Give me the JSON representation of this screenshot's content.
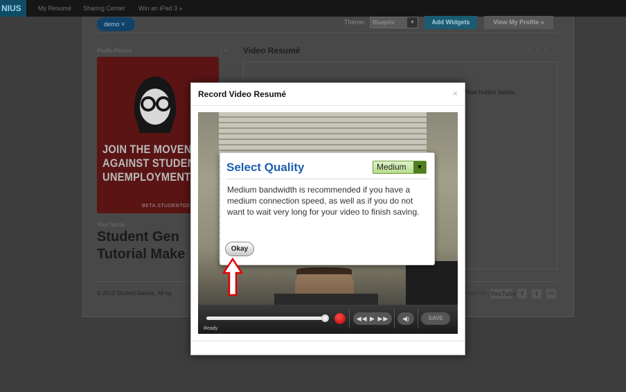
{
  "topbar": {
    "logo": "NIUS",
    "nav": [
      "My Resumé",
      "Sharing Center",
      "Win an iPad 3 »"
    ]
  },
  "toolbar": {
    "demo_label": "demo ˅",
    "theme_label": "Theme:",
    "theme_value": "Blueprint",
    "add_widgets": "Add Widgets",
    "view_profile": "View My Profile »"
  },
  "profile": {
    "picture_label": "Profile Picture",
    "controls": "‹ ×",
    "poster_lines": [
      "JOIN THE MOVEN",
      "AGAINST STUDEN",
      "UNEMPLOYMENT."
    ],
    "poster_footer": "BETA.STUDENTGE",
    "name_label": "Your Name",
    "name_lines": [
      "Student Gen",
      "Tutorial Make"
    ]
  },
  "video_resume": {
    "title": "Video Resumé",
    "controls": "‹ ‹ ›",
    "hint": "Now button below."
  },
  "footer": {
    "copyright": "© 2012 Student Genius. All rig",
    "links": "Contact Us ·",
    "social": [
      "YouTube",
      "f",
      "t",
      "rss"
    ]
  },
  "modal": {
    "title": "Record Video Resumé",
    "close": "×",
    "player": {
      "status": "Ready",
      "save": "SAVE",
      "transport": "◀◀ ▶ ▶▶",
      "volume": "◀)",
      "progress": 1.0
    }
  },
  "quality_dialog": {
    "title": "Select Quality",
    "selected": "Medium",
    "body": "Medium bandwidth is recommended if you have a medium connection speed, as well as if you do not want to wait very long for your video to finish saving.",
    "okay": "Okay"
  },
  "colors": {
    "accent_blue": "#1d5fb0",
    "record_red": "#d80000",
    "annotation_red": "#e00000",
    "quality_green": "#b8dc8e"
  }
}
